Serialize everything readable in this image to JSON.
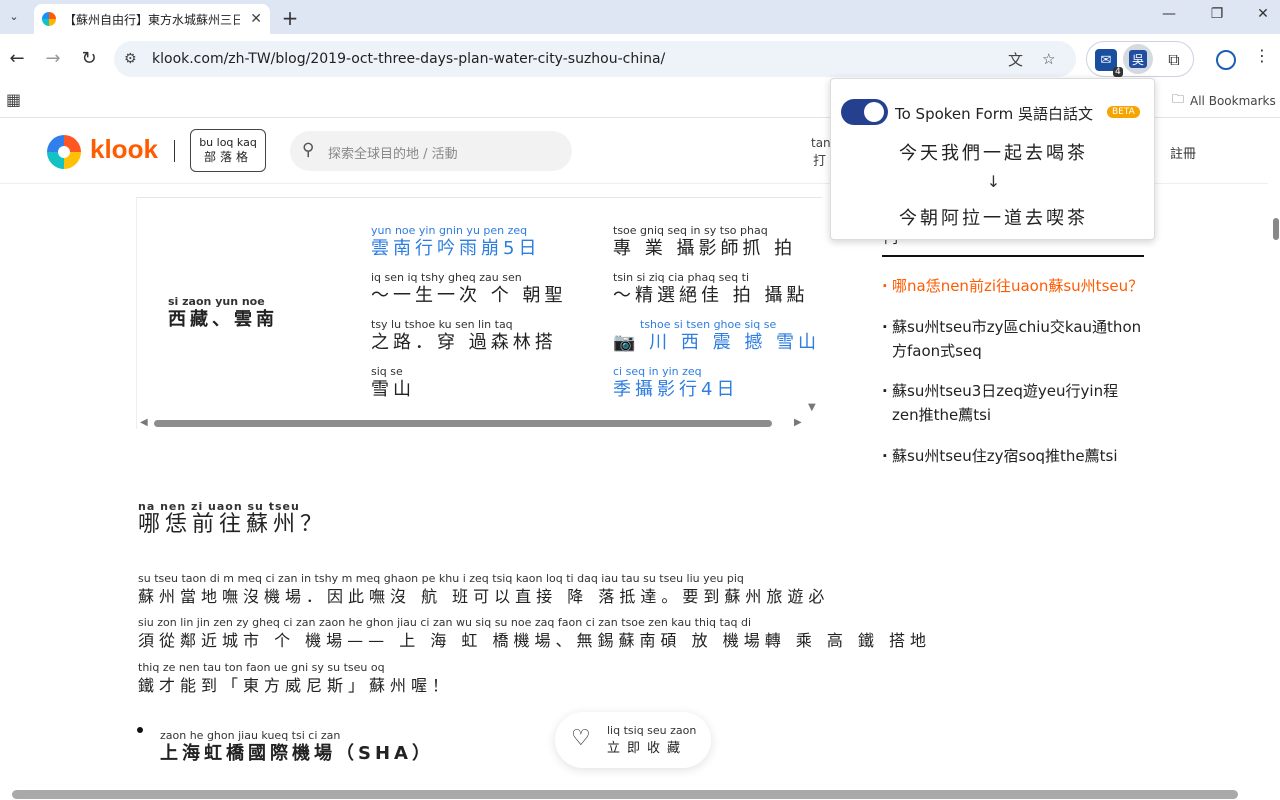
{
  "browser": {
    "tab_title": "【蘇州自由行】東方水城蘇州三日",
    "url": "klook.com/zh-TW/blog/2019-oct-three-days-plan-water-city-suzhou-china/",
    "ext_badge": "4",
    "ext_char": "吳",
    "all_bookmarks": "All Bookmarks"
  },
  "header": {
    "logo": "klook",
    "blog_ruby": "bu loq kaq",
    "blog_base": "部落格",
    "search_placeholder": "探索全球目的地 / 活動",
    "partial_ruby": "tan",
    "partial_base": "打",
    "register": "註冊"
  },
  "popup": {
    "title": "To Spoken Form 吳語白話文",
    "badge": "BETA",
    "source": "今天我們一起去喝茶",
    "arrow": "↓",
    "result": "今朝阿拉一道去喫茶"
  },
  "table": {
    "row_label": {
      "rt": "si  zaon    yun noe",
      "rb": "西藏、雲南"
    },
    "col1": [
      {
        "rt": "yun noe yin gnin  yu  pen    zeq",
        "rb": "雲南行吟雨崩5日",
        "link": true
      },
      {
        "rt": "     iq  sen  iq  tshy gheq zau sen",
        "rb": "～一生一次 个 朝聖",
        "link": false
      },
      {
        "rt": "tsy  lu       tshoe  ku  sen  lin  taq",
        "rb": "之路．穿 過森林搭",
        "link": false
      },
      {
        "rt": "siq  se",
        "rb": "雪山",
        "link": false
      }
    ],
    "col2": [
      {
        "rt": "tsoe gniq seq   in   sy  tso phaq",
        "rb": "專 業 攝影師抓 拍",
        "link": false
      },
      {
        "rt": "   tsin  si  ziq  cia phaq seq  ti",
        "rb": "～精選絕佳 拍 攝點",
        "link": false
      },
      {
        "rt": "tshoe  si  tsen ghoe siq  se",
        "rb": "川 西 震 撼 雪山",
        "link": true,
        "camera": "📷"
      },
      {
        "rt": "ci  seq  in  yin     zeq",
        "rb": "季攝影行4日",
        "link": true
      }
    ]
  },
  "sidebar": {
    "partial": "門 ",
    "items": [
      "哪na恁nen前zi往uaon蘇su州tseu？",
      "蘇su州tseu市zy區chiu交kau通thon方faon式seq",
      "蘇su州tseu3日zeq遊yeu行yin程zen推the薦tsi",
      "蘇su州tseu住zy宿soq推the薦tsi"
    ]
  },
  "article": {
    "heading": {
      "rt": "na  nen   zi   uaon  su  tseu",
      "rb": "哪恁前往蘇州？"
    },
    "lines": [
      {
        "rt": "su tseu taon  di   m  meq  ci  zan       in  tshy  m  meq ghaon pe khu   i    zeq tsiq kaon loq   ti  daq       iau tau su  tseu liu yeu piq",
        "rb": "蘇州當地嘸沒機場．因此嘸沒 航 班可以直接 降 落抵達。要到蘇州旅遊必"
      },
      {
        "rt": "siu zon lin jin zen zy gheq  ci  zan            zaon he ghon jiau  ci  zan        wu siq su noe zaq faon  ci  zan tsoe zen kau thiq taq  di",
        "rb": "須從鄰近城市 个 機場—— 上 海 虹 橋機場、無錫蘇南碩 放 機場轉 乘 高 鐵 搭地"
      },
      {
        "rt": "thiq  ze  nen tau      ton faon ue gni  sy       su tseu oq",
        "rb": "鐵才能到「東方威尼斯」蘇州喔！"
      }
    ],
    "bullet": {
      "rt": "zaon  he  ghon jiau kueq  tsi   ci  zan",
      "rb": "上海虹橋國際機場（SHA）"
    },
    "save": {
      "rt": "liq tsiq seu zaon",
      "rb": "立即收藏"
    }
  }
}
